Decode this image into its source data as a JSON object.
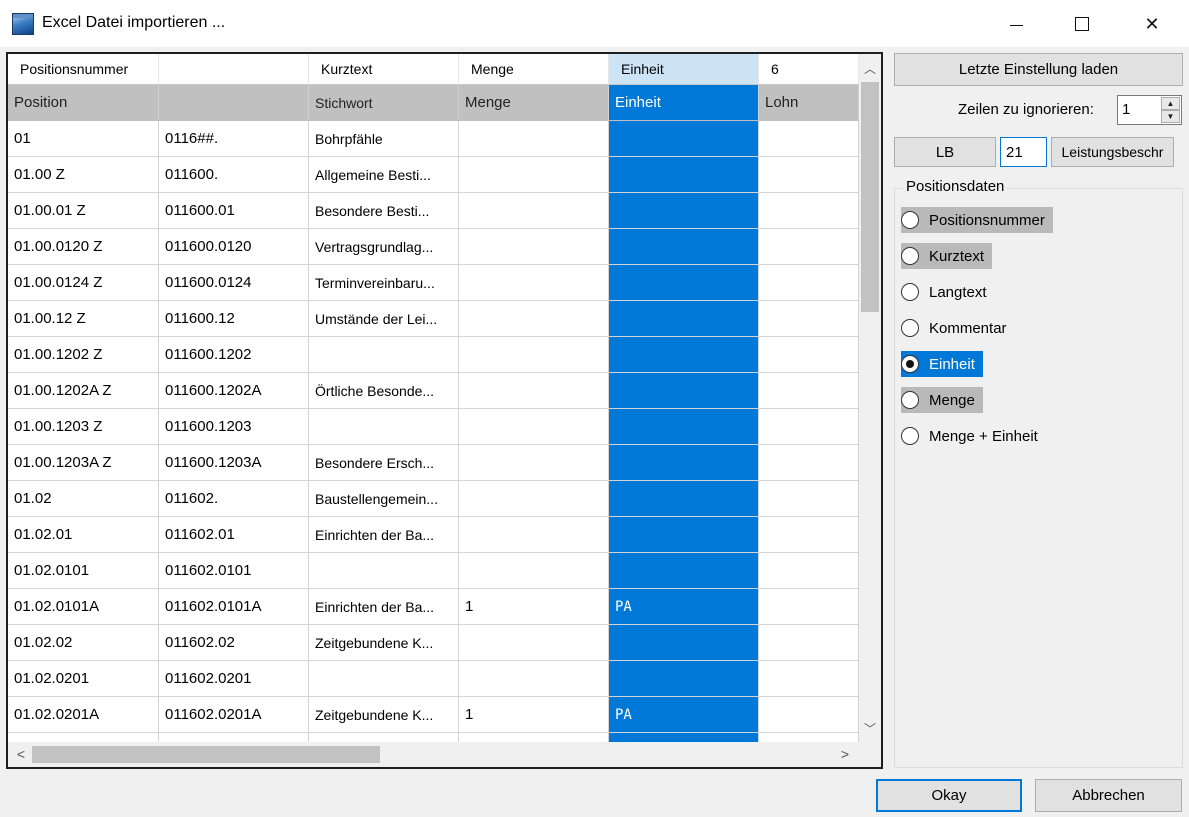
{
  "window": {
    "title": "Excel Datei importieren ...",
    "minimize": "",
    "maximize": "",
    "close": "✕"
  },
  "grid": {
    "header_row": [
      "Positionsnummer",
      "",
      "Kurztext",
      "Menge",
      "Einheit",
      "6"
    ],
    "caption_row": [
      "Position",
      "",
      "Stichwort",
      "Menge",
      "Einheit",
      "Lohn"
    ],
    "rows": [
      [
        "01",
        "0116##.",
        "Bohrpfähle",
        "",
        "",
        ""
      ],
      [
        "01.00  Z",
        "011600.",
        "Allgemeine Besti...",
        "",
        "",
        ""
      ],
      [
        "01.00.01  Z",
        "011600.01",
        "Besondere Besti...",
        "",
        "",
        ""
      ],
      [
        "01.00.0120  Z",
        "011600.0120",
        "Vertragsgrundlag...",
        "",
        "",
        ""
      ],
      [
        "01.00.0124  Z",
        "011600.0124",
        "Terminvereinbaru...",
        "",
        "",
        ""
      ],
      [
        "01.00.12  Z",
        "011600.12",
        "Umstände der Lei...",
        "",
        "",
        ""
      ],
      [
        "01.00.1202  Z",
        "011600.1202",
        "",
        "",
        "",
        ""
      ],
      [
        "01.00.1202A  Z",
        "011600.1202A",
        "Örtliche Besonde...",
        "",
        "",
        ""
      ],
      [
        "01.00.1203  Z",
        "011600.1203",
        "",
        "",
        "",
        ""
      ],
      [
        "01.00.1203A  Z",
        "011600.1203A",
        "Besondere Ersch...",
        "",
        "",
        ""
      ],
      [
        "01.02",
        "011602.",
        "Baustellengemein...",
        "",
        "",
        ""
      ],
      [
        "01.02.01",
        "011602.01",
        "Einrichten der Ba...",
        "",
        "",
        ""
      ],
      [
        "01.02.0101",
        "011602.0101",
        "",
        "",
        "",
        ""
      ],
      [
        "01.02.0101A",
        "011602.0101A",
        "Einrichten der Ba...",
        "1",
        "PA",
        ""
      ],
      [
        "01.02.02",
        "011602.02",
        "Zeitgebundene K...",
        "",
        "",
        ""
      ],
      [
        "01.02.0201",
        "011602.0201",
        "",
        "",
        "",
        ""
      ],
      [
        "01.02.0201A",
        "011602.0201A",
        "Zeitgebundene K...",
        "1",
        "PA",
        ""
      ],
      [
        "",
        "",
        "",
        "",
        "",
        ""
      ]
    ],
    "scroll_up": "︿",
    "scroll_down": "﹀",
    "scroll_left": "<",
    "scroll_right": ">"
  },
  "panel": {
    "load_last_button": "Letzte Einstellung laden",
    "ignore_rows_label": "Zeilen zu ignorieren:",
    "ignore_rows_value": "1",
    "lb_button": "LB",
    "lb_value": "21",
    "leistungsbeschr_button": "Leistungsbeschr",
    "group_title": "Positionsdaten",
    "radios": [
      {
        "label": "Positionsnummer",
        "state": "assigned",
        "checked": false
      },
      {
        "label": "Kurztext",
        "state": "assigned",
        "checked": false
      },
      {
        "label": "Langtext",
        "state": "none",
        "checked": false
      },
      {
        "label": "Kommentar",
        "state": "none",
        "checked": false
      },
      {
        "label": "Einheit",
        "state": "selected",
        "checked": true
      },
      {
        "label": "Menge",
        "state": "assigned",
        "checked": false
      },
      {
        "label": "Menge + Einheit",
        "state": "none",
        "checked": false
      }
    ]
  },
  "footer": {
    "okay_button": "Okay",
    "cancel_button": "Abbrechen"
  },
  "colors": {
    "selection": "#0078d7",
    "assigned": "#b9b9b9",
    "header_highlight": "#cde4f7"
  }
}
